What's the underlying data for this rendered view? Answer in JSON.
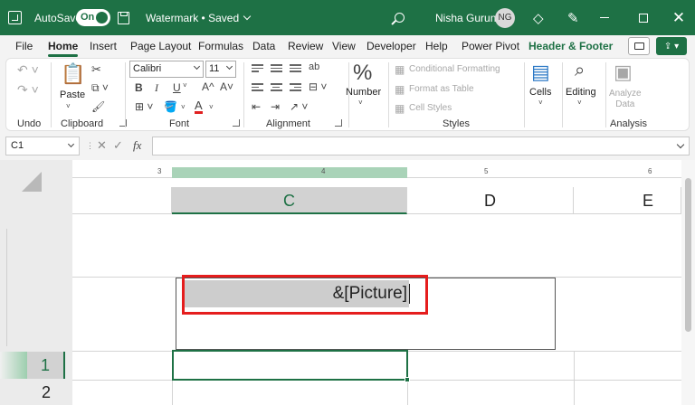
{
  "titlebar": {
    "autosave_label": "AutoSave",
    "autosave_state": "On",
    "doc_title": "Watermark • Saved",
    "user_name": "Nisha Gurung",
    "user_initials": "NG"
  },
  "tabs": [
    "File",
    "Home",
    "Insert",
    "Page Layout",
    "Formulas",
    "Data",
    "Review",
    "View",
    "Developer",
    "Help",
    "Power Pivot",
    "Header & Footer"
  ],
  "ribbon": {
    "groups": {
      "undo": "Undo",
      "clipboard": "Clipboard",
      "font": "Font",
      "alignment": "Alignment",
      "styles": "Styles",
      "analysis": "Analysis"
    },
    "paste_label": "Paste",
    "font_name": "Calibri",
    "font_size": "11",
    "bold": "B",
    "italic": "I",
    "underline": "U",
    "grow_font": "A^",
    "shrink_font": "A˅",
    "number_symbol": "%",
    "number_label": "Number",
    "conditional_formatting": "Conditional Formatting",
    "format_as_table": "Format as Table",
    "cell_styles": "Cell Styles",
    "cells_label": "Cells",
    "editing_label": "Editing",
    "analyze_data_line1": "Analyze",
    "analyze_data_line2": "Data"
  },
  "formula_bar": {
    "name_box": "C1",
    "fx": "fx",
    "content": ""
  },
  "ruler": [
    "3",
    "4",
    "5",
    "6"
  ],
  "columns": [
    "C",
    "D",
    "E"
  ],
  "header_field_text": "&[Picture]",
  "rows": [
    "1",
    "2"
  ]
}
